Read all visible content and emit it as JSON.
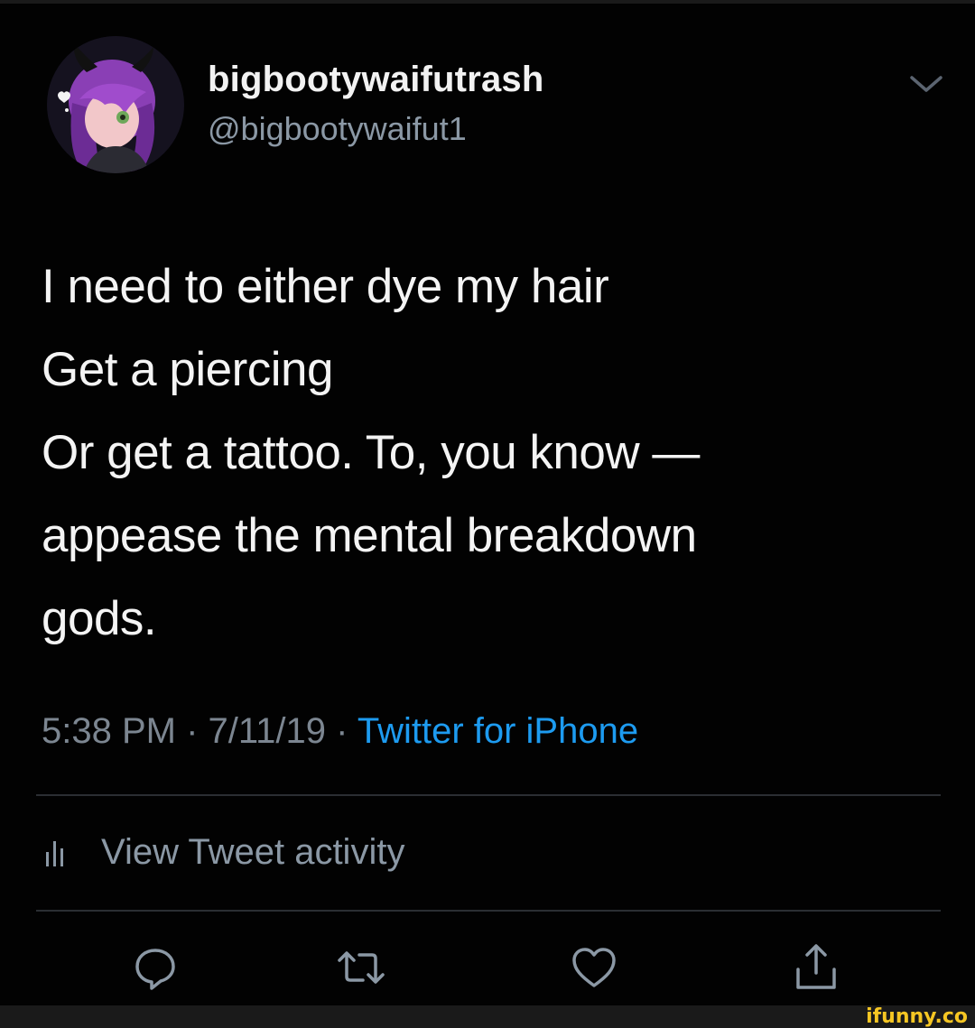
{
  "user": {
    "display_name": "bigbootywaifutrash",
    "handle": "@bigbootywaifut1",
    "avatar": "avatar-icon"
  },
  "tweet": {
    "lines": [
      "I need to either dye my hair",
      "Get a piercing",
      "Or get a tattoo. To, you know —",
      "appease the mental breakdown",
      "gods."
    ],
    "time": "5:38 PM",
    "separator": " · ",
    "date": "7/11/19",
    "source": "Twitter for iPhone"
  },
  "activity": {
    "label": "View Tweet activity",
    "icon": "bar-chart-icon"
  },
  "actions": {
    "reply": "reply-icon",
    "retweet": "retweet-icon",
    "like": "heart-icon",
    "share": "share-icon"
  },
  "menu": {
    "icon": "chevron-down-icon"
  },
  "watermark": {
    "text": "ifunny.co"
  },
  "colors": {
    "background": "#020202",
    "text": "#f4f4f4",
    "secondary": "#8b98a5",
    "link": "#1d9bf0",
    "divider": "#2b2e33"
  }
}
